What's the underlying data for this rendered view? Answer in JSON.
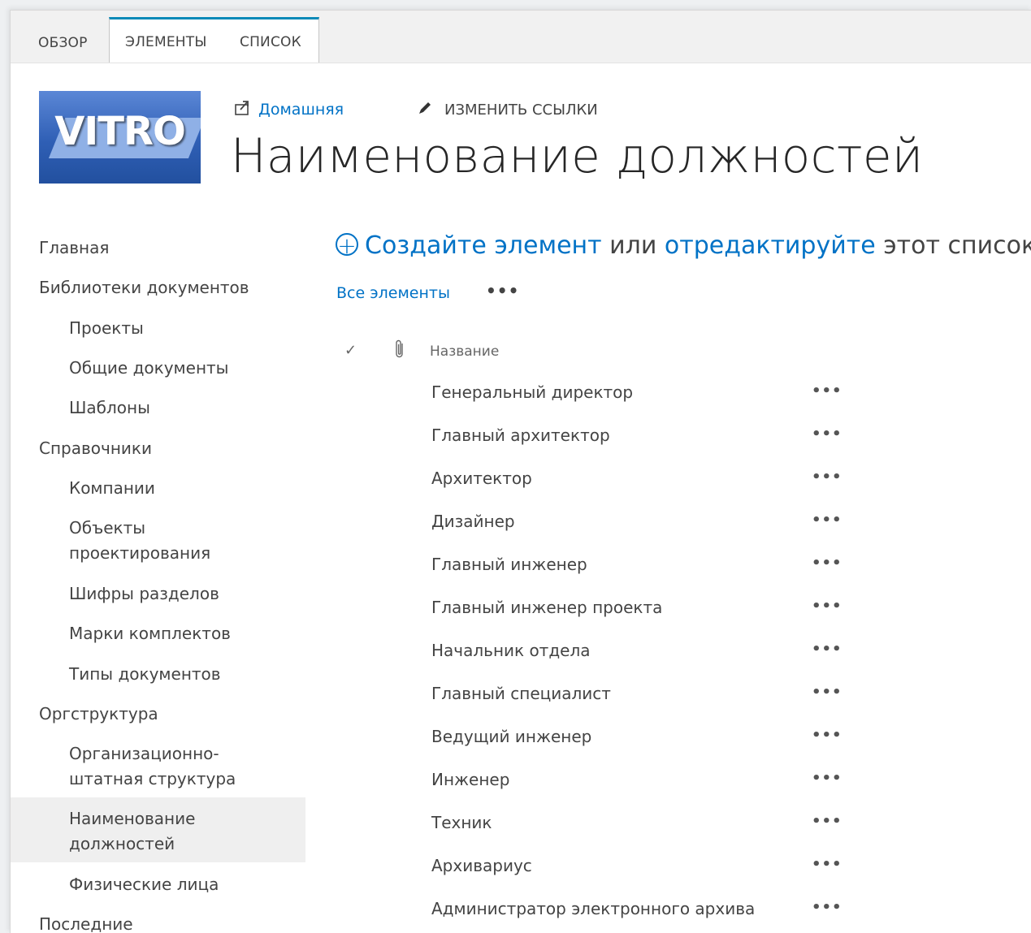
{
  "ribbon": {
    "tabs": [
      "ОБЗОР",
      "ЭЛЕМЕНТЫ",
      "СПИСОК"
    ]
  },
  "logo": {
    "text": "VITRO"
  },
  "header": {
    "home_link": "Домашняя",
    "edit_links": "ИЗМЕНИТЬ ССЫЛКИ",
    "title": "Наименование должностей"
  },
  "nav": {
    "items": [
      "Главная",
      "Библиотеки документов",
      "Проекты",
      "Общие документы",
      "Шаблоны",
      "Справочники",
      "Компании",
      "Объекты",
      "проектирования",
      "Шифры разделов",
      "Марки комплектов",
      "Типы документов",
      "Оргструктура",
      "Организационно-",
      "штатная структура",
      "Наименование",
      "должностей",
      "Физические лица",
      "Последние"
    ]
  },
  "main": {
    "new_prefix": "+",
    "create_link": "Создайте элемент",
    "or_text": " или ",
    "edit_link": "отредактируйте",
    "list_text": " этот список",
    "view_all": "Все элементы",
    "more": "•••",
    "header": {
      "check": "✓",
      "clip": "📎",
      "name": "Название"
    },
    "rows": [
      "Генеральный директор",
      "Главный архитектор",
      "Архитектор",
      "Дизайнер",
      "Главный инженер",
      "Главный инженер проекта",
      "Начальник отдела",
      "Главный специалист",
      "Ведущий инженер",
      "Инженер",
      "Техник",
      "Архивариус",
      "Администратор электронного архива"
    ]
  },
  "colors": {
    "accent": "#0072c6",
    "tab_accent": "#0b8ab8"
  }
}
